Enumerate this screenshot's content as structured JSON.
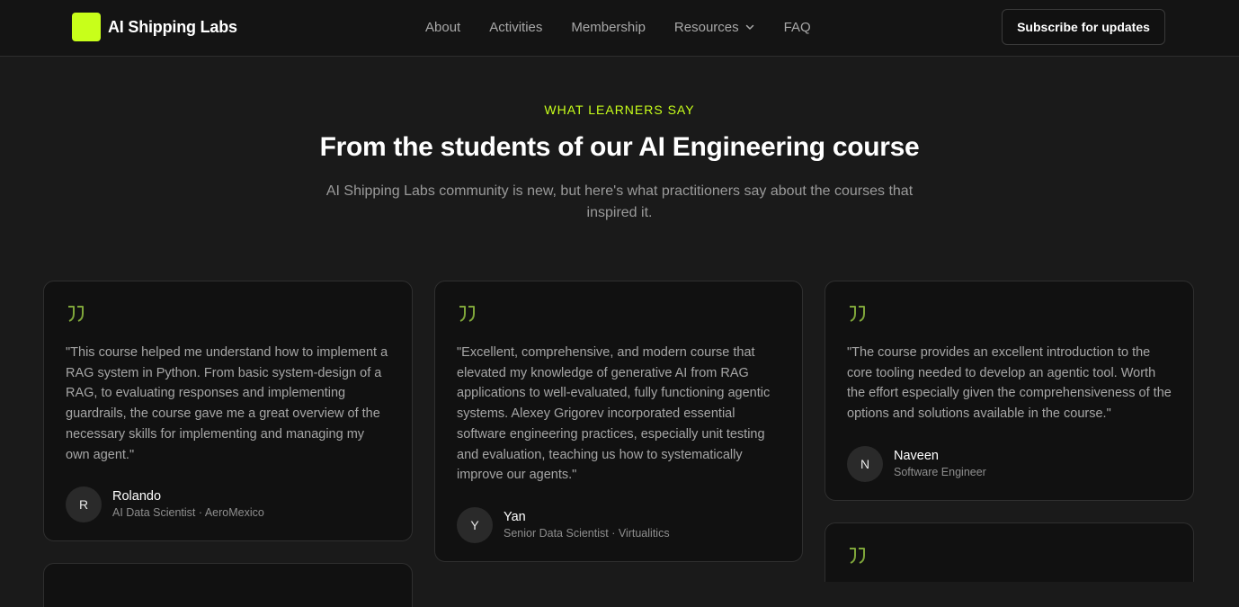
{
  "nav": {
    "brand": "AI Shipping Labs",
    "links": [
      "About",
      "Activities",
      "Membership",
      "Resources",
      "FAQ"
    ],
    "subscribe_label": "Subscribe for updates"
  },
  "section": {
    "eyebrow": "WHAT LEARNERS SAY",
    "title": "From the students of our AI Engineering course",
    "subtitle": "AI Shipping Labs community is new, but here's what practitioners say about the courses that inspired it."
  },
  "testimonials": [
    {
      "quote": "\"This course helped me understand how to implement a RAG system in Python. From basic system-design of a RAG, to evaluating responses and implementing guardrails, the course gave me a great overview of the necessary skills for implementing and managing my own agent.\"",
      "initial": "R",
      "name": "Rolando",
      "role": "AI Data Scientist · AeroMexico"
    },
    {
      "quote": "\"Excellent, comprehensive, and modern course that elevated my knowledge of generative AI from RAG applications to well-evaluated, fully functioning agentic systems. Alexey Grigorev incorporated essential software engineering practices, especially unit testing and evaluation, teaching us how to systematically improve our agents.\"",
      "initial": "Y",
      "name": "Yan",
      "role": "Senior Data Scientist · Virtualitics"
    },
    {
      "quote": "\"The course provides an excellent introduction to the core tooling needed to develop an agentic tool. Worth the effort especially given the comprehensiveness of the options and solutions available in the course.\"",
      "initial": "N",
      "name": "Naveen",
      "role": "Software Engineer"
    }
  ],
  "icons": {
    "quote": "quote-icon",
    "chevron": "chevron-down-icon"
  },
  "colors": {
    "accent": "#c8ff1a",
    "background": "#1a1a1a",
    "card": "#111111",
    "quote_icon": "#7fa63a"
  }
}
